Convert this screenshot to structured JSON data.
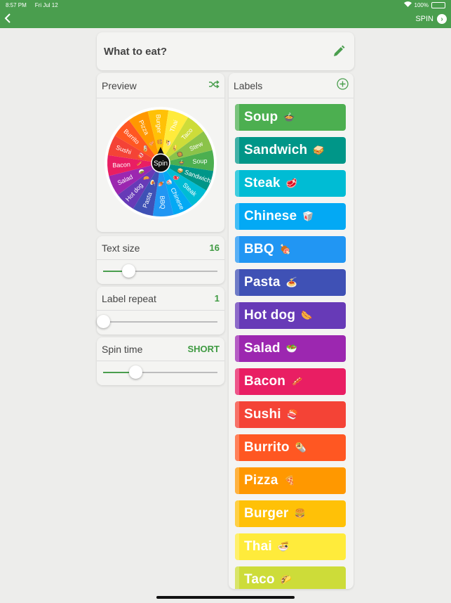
{
  "status": {
    "time": "8:57 PM",
    "date": "Fri Jul 12",
    "battery": "100%"
  },
  "nav": {
    "back_icon": "chevron-left-icon",
    "spin_label": "SPIN"
  },
  "title": {
    "text": "What to eat?",
    "edit_icon": "pencil-icon"
  },
  "preview": {
    "label": "Preview",
    "shuffle_icon": "shuffle-icon",
    "center_label": "Spin"
  },
  "text_size": {
    "label": "Text size",
    "value": "16",
    "level": 0.22
  },
  "label_repeat": {
    "label": "Label repeat",
    "value": "1",
    "level": 0.0
  },
  "spin_time": {
    "label": "Spin time",
    "value": "SHORT",
    "level": 0.28
  },
  "labels": {
    "header": "Labels",
    "add_icon": "add-circle-icon",
    "items": [
      {
        "label": "Soup",
        "emoji": "🍲",
        "color": "#4caf50"
      },
      {
        "label": "Sandwich",
        "emoji": "🥪",
        "color": "#009688"
      },
      {
        "label": "Steak",
        "emoji": "🥩",
        "color": "#00bcd4"
      },
      {
        "label": "Chinese",
        "emoji": "🥡",
        "color": "#03a9f4"
      },
      {
        "label": "BBQ",
        "emoji": "🍖",
        "color": "#2196f3"
      },
      {
        "label": "Pasta",
        "emoji": "🍝",
        "color": "#3f51b5"
      },
      {
        "label": "Hot dog",
        "emoji": "🌭",
        "color": "#673ab7"
      },
      {
        "label": "Salad",
        "emoji": "🥗",
        "color": "#9c27b0"
      },
      {
        "label": "Bacon",
        "emoji": "🥓",
        "color": "#e91e63"
      },
      {
        "label": "Sushi",
        "emoji": "🍣",
        "color": "#f44336"
      },
      {
        "label": "Burrito",
        "emoji": "🌯",
        "color": "#ff5722"
      },
      {
        "label": "Pizza",
        "emoji": "🍕",
        "color": "#ff9800"
      },
      {
        "label": "Burger",
        "emoji": "🍔",
        "color": "#ffc107"
      },
      {
        "label": "Thai",
        "emoji": "🍜",
        "color": "#ffeb3b"
      },
      {
        "label": "Taco",
        "emoji": "🌮",
        "color": "#cddc39"
      }
    ]
  },
  "wheel_order": [
    "Soup",
    "Sandwich",
    "Steak",
    "Chinese",
    "BBQ",
    "Pasta",
    "Hot dog",
    "Salad",
    "Bacon",
    "Sushi",
    "Burrito",
    "Pizza",
    "Burger",
    "Thai",
    "Taco",
    "Stew"
  ],
  "wheel_extra": {
    "label": "Stew",
    "emoji": "🥘",
    "color": "#8bc34a"
  }
}
